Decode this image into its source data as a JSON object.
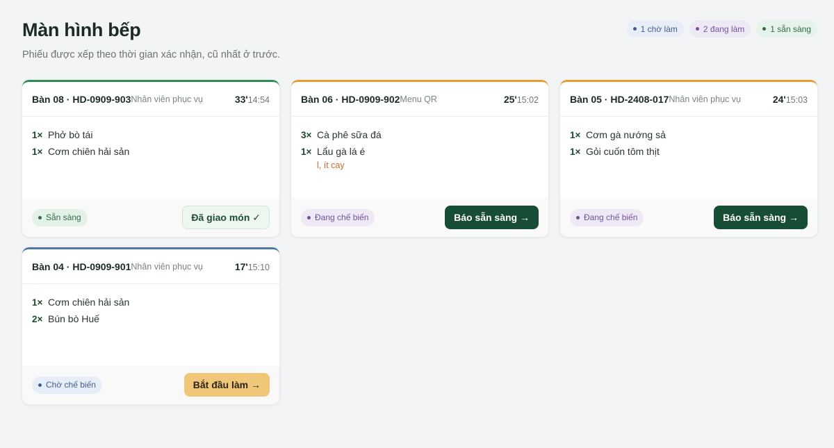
{
  "page": {
    "title": "Màn hình bếp",
    "subtitle": "Phiếu được xếp theo thời gian xác nhận, cũ nhất ở trước."
  },
  "counts": [
    {
      "label": "1 chờ làm",
      "color": "#3d5f8e"
    },
    {
      "label": "2 đang làm",
      "color": "#7352a0"
    },
    {
      "label": "1 sẵn sàng",
      "color": "#2f6b44"
    }
  ],
  "tickets": [
    {
      "table": "Bàn 08 · HD-0909-903",
      "source": "Nhân viên phục vụ",
      "elapsed": "33'",
      "time": "14:54",
      "accent": "#2f8a57",
      "items": [
        {
          "qty": "1×",
          "name": "Phở bò tái"
        },
        {
          "qty": "1×",
          "name": "Cơm chiên hải sản"
        }
      ],
      "status": "Sẵn sàng",
      "action": "Đã giao món ✓"
    },
    {
      "table": "Bàn 06 · HD-0909-902",
      "source": "Menu QR",
      "elapsed": "25'",
      "time": "15:02",
      "accent": "#e69a36",
      "items": [
        {
          "qty": "3×",
          "name": "Cà phê sữa đá"
        },
        {
          "qty": "1×",
          "name": "Lẩu gà lá é",
          "note": "l, ít cay"
        }
      ],
      "status": "Đang chế biến",
      "action": "Báo sẵn sàng →"
    },
    {
      "table": "Bàn 05 · HD-2408-017",
      "source": "Nhân viên phục vụ",
      "elapsed": "24'",
      "time": "15:03",
      "accent": "#e69a36",
      "items": [
        {
          "qty": "1×",
          "name": "Cơm gà nướng sả"
        },
        {
          "qty": "1×",
          "name": "Gỏi cuốn tôm thịt"
        }
      ],
      "status": "Đang chế biến",
      "action": "Báo sẵn sàng →"
    },
    {
      "table": "Bàn 04 · HD-0909-901",
      "source": "Nhân viên phục vụ",
      "elapsed": "17'",
      "time": "15:10",
      "accent": "#4a79a8",
      "items": [
        {
          "qty": "1×",
          "name": "Cơm chiên hải sản"
        },
        {
          "qty": "2×",
          "name": "Bún bò Huế"
        }
      ],
      "status": "Chờ chế biến",
      "action": "Bắt đầu làm →"
    }
  ]
}
